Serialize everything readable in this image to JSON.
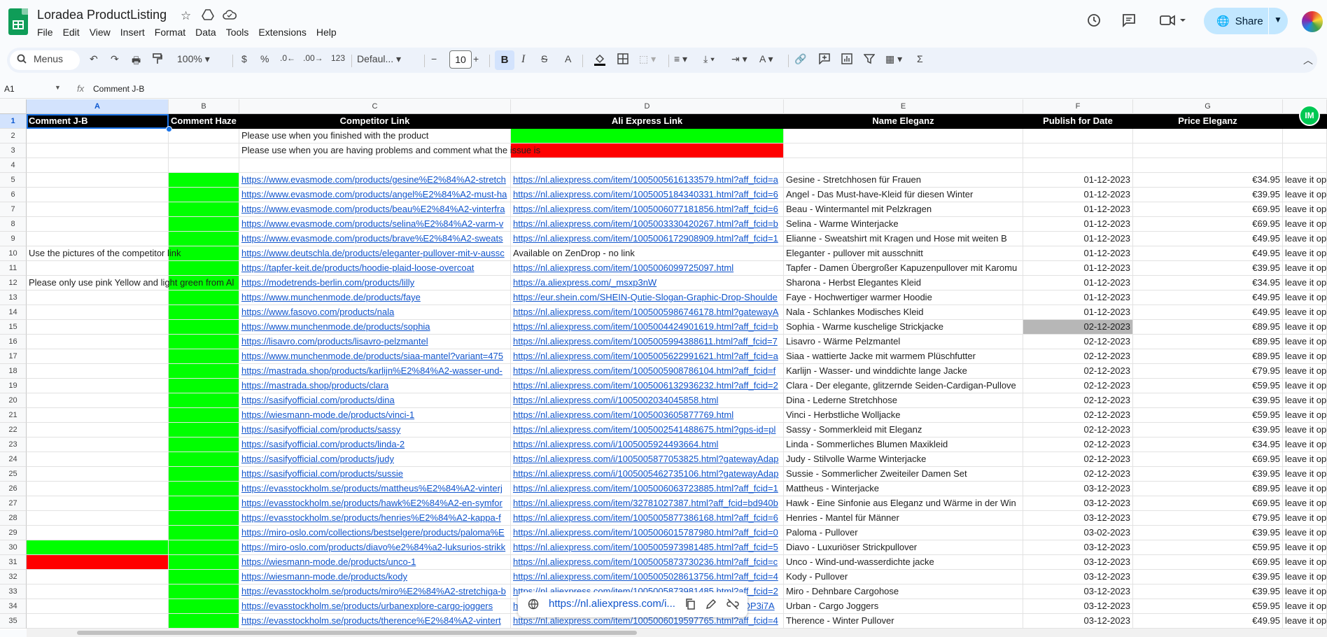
{
  "app": {
    "title": "Loradea ProductListing",
    "menus": [
      "File",
      "Edit",
      "View",
      "Insert",
      "Format",
      "Data",
      "Tools",
      "Extensions",
      "Help"
    ],
    "share_label": "Share",
    "icons": [
      "star-icon",
      "move-to-drive-icon",
      "cloud-status-icon",
      "version-history-icon",
      "comments-icon",
      "video-call-icon"
    ]
  },
  "toolbar": {
    "search_label": "Menus",
    "zoom": "100%",
    "currency": "$",
    "percent": "%",
    "dec_decrease": ".0←",
    "dec_increase": ".00→",
    "number_format": "123",
    "font": "Defaul...",
    "font_size": "10",
    "bold": "B",
    "italic": "I"
  },
  "formula_bar": {
    "cell_ref": "A1",
    "fx": "fx",
    "content": "Comment J-B"
  },
  "sheet": {
    "columns": [
      "A",
      "B",
      "C",
      "D",
      "E",
      "F",
      "G"
    ],
    "headers": [
      "Comment J-B",
      "Comment Haze",
      "Competitor Link",
      "Ali Express Link",
      "Name Eleganz",
      "Publish for Date",
      "Price Eleganz"
    ],
    "badge": "IM",
    "legend": {
      "done": "Please use when you finished with the product",
      "problem": "Please use when you are having problems and comment what the issue is"
    },
    "rows": [
      {
        "n": "5",
        "a": "",
        "b": "g",
        "c": "https://www.evasmode.com/products/gesine%E2%84%A2-stretch",
        "d": "https://nl.aliexpress.com/item/1005005616133579.html?aff_fcid=a",
        "e": "Gesine - Stretchhosen für Frauen",
        "f": "01-12-2023",
        "g": "€34.95",
        "h": "leave it op"
      },
      {
        "n": "6",
        "a": "",
        "b": "g",
        "c": "https://www.evasmode.com/products/angel%E2%84%A2-must-ha",
        "d": "https://nl.aliexpress.com/item/1005005184340331.html?aff_fcid=6",
        "e": "Angel - Das Must-have-Kleid für diesen Winter",
        "f": "01-12-2023",
        "g": "€39.95",
        "h": "leave it op"
      },
      {
        "n": "7",
        "a": "",
        "b": "g",
        "c": "https://www.evasmode.com/products/beau%E2%84%A2-vinterfra",
        "d": "https://nl.aliexpress.com/item/1005006077181856.html?aff_fcid=6",
        "e": "Beau - Wintermantel mit Pelzkragen",
        "f": "01-12-2023",
        "g": "€69.95",
        "h": "leave it op"
      },
      {
        "n": "8",
        "a": "",
        "b": "g",
        "c": "https://www.evasmode.com/products/selina%E2%84%A2-varm-v",
        "d": "https://nl.aliexpress.com/item/1005003330420267.html?aff_fcid=b",
        "e": "Selina - Warme Winterjacke",
        "f": "01-12-2023",
        "g": "€69.95",
        "h": "leave it op"
      },
      {
        "n": "9",
        "a": "",
        "b": "g",
        "c": "https://www.evasmode.com/products/brave%E2%84%A2-sweats",
        "d": "https://nl.aliexpress.com/item/1005006172908909.html?aff_fcid=1",
        "e": "Elianne - Sweatshirt mit Kragen und Hose mit weiten B",
        "f": "01-12-2023",
        "g": "€49.95",
        "h": "leave it op"
      },
      {
        "n": "10",
        "a": "Use the pictures of the competitor link",
        "b": "g",
        "c": "https://www.deutschla.de/products/eleganter-pullover-mit-v-aussc",
        "d": "Available on ZenDrop - no link",
        "dplain": true,
        "e": "Eleganter - pullover mit ausschnitt",
        "f": "01-12-2023",
        "g": "€49.95",
        "h": "leave it op"
      },
      {
        "n": "11",
        "a": "",
        "b": "g",
        "c": "https://tapfer-keit.de/products/hoodie-plaid-loose-overcoat",
        "d": "https://nl.aliexpress.com/item/1005006099725097.html",
        "e": "Tapfer - Damen Übergroßer Kapuzenpullover mit Karomu",
        "f": "01-12-2023",
        "g": "€39.95",
        "h": "leave it op"
      },
      {
        "n": "12",
        "a": "Please only use pink Yellow and light green from Al",
        "b": "g",
        "c": "https://modetrends-berlin.com/products/lilly",
        "d": "https://a.aliexpress.com/_msxp3nW",
        "e": "Sharona - Herbst Elegantes Kleid",
        "f": "01-12-2023",
        "g": "€34.95",
        "h": "leave it op"
      },
      {
        "n": "13",
        "a": "",
        "b": "g",
        "c": "https://www.munchenmode.de/products/faye",
        "d": "https://eur.shein.com/SHEIN-Qutie-Slogan-Graphic-Drop-Shoulde",
        "e": "Faye - Hochwertiger warmer Hoodie",
        "f": "01-12-2023",
        "g": "€49.95",
        "h": "leave it op"
      },
      {
        "n": "14",
        "a": "",
        "b": "g",
        "c": "https://www.fasovo.com/products/nala",
        "d": "https://nl.aliexpress.com/item/1005005986746178.html?gatewayA",
        "e": "Nala - Schlankes Modisches Kleid",
        "f": "01-12-2023",
        "g": "€49.95",
        "h": "leave it op"
      },
      {
        "n": "15",
        "a": "",
        "b": "g",
        "c": "https://www.munchenmode.de/products/sophia",
        "d": "https://nl.aliexpress.com/item/1005004424901619.html?aff_fcid=b",
        "e": "Sophia - Warme kuschelige Strickjacke",
        "f": "02-12-2023",
        "fgray": true,
        "g": "€89.95",
        "h": "leave it op"
      },
      {
        "n": "16",
        "a": "",
        "b": "g",
        "c": "https://lisavro.com/products/lisavro-pelzmantel",
        "d": "https://nl.aliexpress.com/item/1005005994388611.html?aff_fcid=7",
        "e": "Lisavro - Wärme Pelzmantel",
        "f": "02-12-2023",
        "g": "€89.95",
        "h": "leave it op"
      },
      {
        "n": "17",
        "a": "",
        "b": "g",
        "c": "https://www.munchenmode.de/products/siaa-mantel?variant=475",
        "d": "https://nl.aliexpress.com/item/1005005622991621.html?aff_fcid=a",
        "e": "Siaa - wattierte Jacke mit warmem Plüschfutter",
        "f": "02-12-2023",
        "g": "€89.95",
        "h": "leave it op"
      },
      {
        "n": "18",
        "a": "",
        "b": "g",
        "c": "https://mastrada.shop/products/karlijn%E2%84%A2-wasser-und-",
        "d": "https://nl.aliexpress.com/item/1005005908786104.html?aff_fcid=f",
        "e": "Karlijn - Wasser- und winddichte lange Jacke",
        "f": "02-12-2023",
        "g": "€79.95",
        "h": "leave it op"
      },
      {
        "n": "19",
        "a": "",
        "b": "g",
        "c": "https://mastrada.shop/products/clara",
        "d": "https://nl.aliexpress.com/item/1005006132936232.html?aff_fcid=2",
        "e": "Clara - Der elegante, glitzernde Seiden-Cardigan-Pullove",
        "f": "02-12-2023",
        "g": "€59.95",
        "h": "leave it op"
      },
      {
        "n": "20",
        "a": "",
        "b": "g",
        "c": "https://sasifyofficial.com/products/dina",
        "d": "https://nl.aliexpress.com/i/1005002034045858.html",
        "e": "Dina - Lederne Stretchhose",
        "f": "02-12-2023",
        "g": "€39.95",
        "h": "leave it op"
      },
      {
        "n": "21",
        "a": "",
        "b": "g",
        "c": "https://wiesmann-mode.de/products/vinci-1",
        "d": "https://nl.aliexpress.com/item/1005003605877769.html",
        "e": "Vinci - Herbstliche Wolljacke",
        "f": "02-12-2023",
        "g": "€59.95",
        "h": "leave it op"
      },
      {
        "n": "22",
        "a": "",
        "b": "g",
        "c": "https://sasifyofficial.com/products/sassy",
        "d": "https://nl.aliexpress.com/item/1005002541488675.html?gps-id=pl",
        "e": "Sassy - Sommerkleid mit Eleganz",
        "f": "02-12-2023",
        "g": "€39.95",
        "h": "leave it op"
      },
      {
        "n": "23",
        "a": "",
        "b": "g",
        "c": "https://sasifyofficial.com/products/linda-2",
        "d": "https://nl.aliexpress.com/i/1005005924493664.html",
        "e": "Linda - Sommerliches Blumen Maxikleid",
        "f": "02-12-2023",
        "g": "€34.95",
        "h": "leave it op"
      },
      {
        "n": "24",
        "a": "",
        "b": "g",
        "c": "https://sasifyofficial.com/products/judy",
        "d": "https://nl.aliexpress.com/i/1005005877053825.html?gatewayAdap",
        "e": "Judy - Stilvolle Warme Winterjacke",
        "f": "02-12-2023",
        "g": "€69.95",
        "h": "leave it op"
      },
      {
        "n": "25",
        "a": "",
        "b": "g",
        "c": "https://sasifyofficial.com/products/sussie",
        "d": "https://nl.aliexpress.com/i/1005005462735106.html?gatewayAdap",
        "e": "Sussie - Sommerlicher Zweiteiler Damen Set",
        "f": "02-12-2023",
        "g": "€39.95",
        "h": "leave it op"
      },
      {
        "n": "26",
        "a": "",
        "b": "g",
        "c": "https://evasstockholm.se/products/mattheus%E2%84%A2-vinterj",
        "d": "https://nl.aliexpress.com/item/1005006063723885.html?aff_fcid=1",
        "e": "Mattheus - Winterjacke",
        "f": "03-12-2023",
        "g": "€89.95",
        "h": "leave it op"
      },
      {
        "n": "27",
        "a": "",
        "b": "g",
        "c": "https://evasstockholm.se/products/hawk%E2%84%A2-en-symfor",
        "d": "https://nl.aliexpress.com/item/32781027387.html?aff_fcid=bd940b",
        "e": "Hawk - Eine Sinfonie aus Eleganz und Wärme in der Win",
        "f": "03-12-2023",
        "g": "€69.95",
        "h": "leave it op"
      },
      {
        "n": "28",
        "a": "",
        "b": "g",
        "c": "https://evasstockholm.se/products/henries%E2%84%A2-kappa-f",
        "d": "https://nl.aliexpress.com/item/1005005877386168.html?aff_fcid=6",
        "e": "Henries - Mantel für Männer",
        "f": "03-12-2023",
        "g": "€79.95",
        "h": "leave it op"
      },
      {
        "n": "29",
        "a": "",
        "b": "g",
        "c": "https://miro-oslo.com/collections/bestselgere/products/paloma%E",
        "d": "https://nl.aliexpress.com/item/1005006015787980.html?aff_fcid=0",
        "e": "Paloma - Pullover",
        "f": "03-02-2023",
        "g": "€39.95",
        "h": "leave it op"
      },
      {
        "n": "30",
        "a": "",
        "acol": "g",
        "b": "g",
        "c": "https://miro-oslo.com/products/diavo%e2%84%a2-luksurios-strikk",
        "d": "https://nl.aliexpress.com/item/1005005973981485.html?aff_fcid=5",
        "e": "Diavo - Luxuriöser Strickpullover",
        "f": "03-12-2023",
        "g": "€59.95",
        "h": "leave it op"
      },
      {
        "n": "31",
        "a": "",
        "acol": "r",
        "b": "g",
        "c": "https://wiesmann-mode.de/products/unco-1",
        "d": "https://nl.aliexpress.com/item/1005005873730236.html?aff_fcid=c",
        "e": "Unco - Wind-und-wasserdichte jacke",
        "f": "03-12-2023",
        "g": "€69.95",
        "h": "leave it op"
      },
      {
        "n": "32",
        "a": "",
        "b": "g",
        "c": "https://wiesmann-mode.de/products/kody",
        "d": "https://nl.aliexpress.com/item/1005005028613756.html?aff_fcid=4",
        "e": "Kody - Pullover",
        "f": "03-12-2023",
        "g": "€39.95",
        "h": "leave it op"
      },
      {
        "n": "33",
        "a": "",
        "b": "g",
        "c": "https://evasstockholm.se/products/miro%E2%84%A2-stretchiga-b",
        "d": "https://nl.aliexpress.com/item/1005005873981485.html?aff_fcid=2",
        "e": "Miro - Dehnbare Cargohose",
        "f": "03-12-2023",
        "g": "€39.95",
        "h": "leave it op"
      },
      {
        "n": "34",
        "a": "",
        "b": "g",
        "c": "https://evasstockholm.se/products/urbanexplore-cargo-joggers",
        "d": "https://nl.aliexpress.com/item/1005005873981485.html?nDP3i7A",
        "e": "Urban - Cargo Joggers",
        "f": "03-12-2023",
        "g": "€59.95",
        "h": "leave it op"
      },
      {
        "n": "35",
        "a": "",
        "b": "g",
        "c": "https://evasstockholm.se/products/therence%E2%84%A2-vintert",
        "d": "https://nl.aliexpress.com/item/1005006019597765.html?aff_fcid=4",
        "e": "Therence - Winter Pullover",
        "f": "03-12-2023",
        "g": "€49.95",
        "h": "leave it op"
      }
    ]
  },
  "link_chip": {
    "url": "https://nl.aliexpress.com/i..."
  }
}
